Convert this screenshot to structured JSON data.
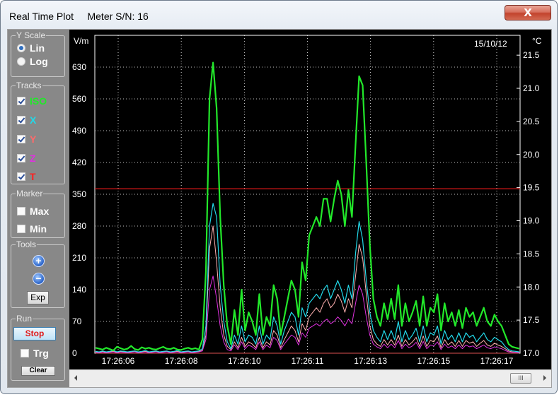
{
  "window": {
    "title": "Real Time Plot     Meter S/N: 16",
    "close_label": "X"
  },
  "sidebar": {
    "y_scale": {
      "label": "Y Scale",
      "options": [
        {
          "label": "Lin",
          "selected": true
        },
        {
          "label": "Log",
          "selected": false
        }
      ]
    },
    "tracks": {
      "label": "Tracks",
      "items": [
        {
          "label": "ISO",
          "checked": true,
          "color": "#22e82a"
        },
        {
          "label": "X",
          "checked": true,
          "color": "#22d8e8"
        },
        {
          "label": "Y",
          "checked": true,
          "color": "#ff6a6a"
        },
        {
          "label": "Z",
          "checked": true,
          "color": "#e030e0"
        },
        {
          "label": "T",
          "checked": true,
          "color": "#ff2020"
        }
      ]
    },
    "marker": {
      "label": "Marker",
      "items": [
        {
          "label": "Max",
          "checked": false
        },
        {
          "label": "Min",
          "checked": false
        }
      ]
    },
    "tools": {
      "label": "Tools",
      "zoom_in": "+",
      "zoom_out": "−",
      "export_label": "Exp"
    },
    "run": {
      "label": "Run",
      "stop_label": "Stop",
      "trg_label": "Trg",
      "trg_checked": false,
      "clear_label": "Clear"
    }
  },
  "plot": {
    "date": "15/10/12",
    "left_unit": "V/m",
    "right_unit": "°C",
    "scrollbar_thumb": "III"
  },
  "chart_data": {
    "type": "line",
    "title": "",
    "xlabel": "",
    "ylabel": "V/m",
    "y2label": "°C",
    "x_ticks": [
      "17:26:06",
      "17:26:08",
      "17:26:10",
      "17:26:11",
      "17:26:13",
      "17:26:15",
      "17:26:17"
    ],
    "y_ticks": [
      0,
      70,
      140,
      210,
      280,
      350,
      420,
      490,
      560,
      630
    ],
    "y2_ticks": [
      "17.0",
      "17.5",
      "18.0",
      "18.5",
      "19.0",
      "19.5",
      "20.0",
      "20.5",
      "21.0",
      "21.5"
    ],
    "ylim": [
      0,
      700
    ],
    "y2lim": [
      17.0,
      21.8
    ],
    "grid": true,
    "reference_line": {
      "value": 362,
      "color": "#e01818"
    },
    "series": [
      {
        "key": "iso",
        "color": "#22e82a",
        "width": 2.2,
        "values": [
          12,
          10,
          8,
          12,
          9,
          6,
          14,
          11,
          8,
          10,
          16,
          9,
          7,
          13,
          10,
          12,
          9,
          8,
          11,
          14,
          10,
          9,
          12,
          8,
          7,
          10,
          12,
          9,
          11,
          8,
          30,
          180,
          560,
          640,
          540,
          300,
          150,
          60,
          20,
          95,
          40,
          140,
          50,
          90,
          70,
          40,
          130,
          40,
          80,
          60,
          150,
          120,
          40,
          80,
          120,
          160,
          140,
          80,
          200,
          160,
          260,
          280,
          300,
          280,
          340,
          340,
          290,
          340,
          380,
          350,
          280,
          360,
          300,
          460,
          610,
          590,
          420,
          240,
          120,
          80,
          60,
          110,
          75,
          120,
          75,
          150,
          60,
          110,
          70,
          90,
          115,
          60,
          125,
          60,
          100,
          90,
          130,
          50,
          110,
          70,
          90,
          60,
          95,
          55,
          100,
          80,
          90,
          60,
          80,
          100,
          70,
          60,
          85,
          70,
          60,
          40,
          20,
          14,
          12,
          10
        ]
      },
      {
        "key": "x",
        "color": "#22d8e8",
        "width": 1.2,
        "values": [
          4,
          3,
          5,
          3,
          4,
          6,
          3,
          5,
          4,
          3,
          4,
          5,
          3,
          4,
          6,
          3,
          4,
          5,
          3,
          4,
          5,
          3,
          4,
          6,
          3,
          4,
          5,
          3,
          4,
          5,
          10,
          60,
          280,
          330,
          300,
          150,
          70,
          25,
          10,
          40,
          20,
          60,
          25,
          40,
          35,
          20,
          60,
          20,
          40,
          30,
          80,
          60,
          20,
          50,
          70,
          90,
          80,
          40,
          100,
          80,
          110,
          120,
          130,
          120,
          140,
          150,
          120,
          140,
          160,
          140,
          110,
          150,
          120,
          220,
          290,
          250,
          160,
          90,
          50,
          35,
          25,
          50,
          30,
          50,
          30,
          70,
          25,
          50,
          30,
          40,
          55,
          25,
          60,
          25,
          45,
          40,
          60,
          20,
          50,
          30,
          40,
          25,
          45,
          25,
          45,
          35,
          40,
          25,
          35,
          45,
          30,
          25,
          35,
          30,
          25,
          15,
          8,
          5,
          4,
          3
        ]
      },
      {
        "key": "y",
        "color": "#ffb0b0",
        "width": 1.0,
        "values": [
          3,
          2,
          4,
          2,
          3,
          4,
          2,
          4,
          3,
          2,
          3,
          4,
          2,
          3,
          4,
          2,
          3,
          4,
          2,
          3,
          4,
          2,
          3,
          4,
          2,
          3,
          4,
          2,
          3,
          4,
          6,
          40,
          230,
          280,
          200,
          100,
          40,
          15,
          8,
          25,
          12,
          35,
          15,
          25,
          20,
          12,
          35,
          12,
          25,
          18,
          50,
          40,
          12,
          30,
          45,
          60,
          50,
          25,
          65,
          50,
          80,
          90,
          100,
          90,
          110,
          120,
          100,
          110,
          130,
          115,
          90,
          120,
          100,
          170,
          240,
          210,
          130,
          60,
          30,
          20,
          15,
          30,
          18,
          30,
          18,
          40,
          15,
          30,
          18,
          25,
          35,
          15,
          38,
          15,
          28,
          25,
          38,
          12,
          30,
          18,
          25,
          15,
          28,
          15,
          28,
          22,
          25,
          15,
          22,
          28,
          18,
          15,
          22,
          18,
          15,
          10,
          5,
          3,
          2,
          2
        ]
      },
      {
        "key": "z",
        "color": "#e030e0",
        "width": 1.0,
        "values": [
          2,
          1,
          2,
          1,
          2,
          3,
          1,
          2,
          2,
          1,
          2,
          3,
          1,
          2,
          3,
          1,
          2,
          3,
          1,
          2,
          3,
          1,
          2,
          3,
          1,
          2,
          3,
          1,
          2,
          3,
          5,
          30,
          140,
          170,
          120,
          60,
          25,
          8,
          5,
          18,
          8,
          25,
          10,
          18,
          14,
          8,
          25,
          8,
          18,
          12,
          35,
          28,
          8,
          20,
          30,
          40,
          35,
          18,
          45,
          35,
          55,
          60,
          65,
          60,
          70,
          75,
          65,
          70,
          80,
          72,
          60,
          75,
          65,
          110,
          150,
          130,
          80,
          40,
          20,
          14,
          10,
          20,
          12,
          20,
          12,
          28,
          10,
          20,
          12,
          16,
          24,
          10,
          26,
          10,
          18,
          16,
          25,
          8,
          20,
          12,
          16,
          10,
          18,
          10,
          18,
          14,
          16,
          10,
          14,
          18,
          12,
          10,
          14,
          12,
          10,
          6,
          3,
          2,
          2,
          1
        ]
      },
      {
        "key": "t",
        "color": "#d21818",
        "width": 0.8,
        "values": [
          0,
          0,
          0,
          0,
          0,
          0,
          0,
          0,
          0,
          0,
          0,
          0,
          0,
          0,
          0,
          0,
          0,
          0,
          0,
          0,
          0,
          0,
          0,
          0,
          0,
          0,
          0,
          0,
          0,
          0,
          0,
          0,
          0,
          0,
          0,
          0,
          0,
          0,
          0,
          0,
          0,
          0,
          0,
          0,
          0,
          0,
          0,
          0,
          0,
          0,
          0,
          0,
          0,
          0,
          0,
          0,
          0,
          0,
          0,
          0,
          0,
          0,
          0,
          0,
          0,
          0,
          0,
          0,
          0,
          0,
          0,
          0,
          0,
          0,
          0,
          0,
          0,
          0,
          0,
          0,
          0,
          0,
          0,
          0,
          0,
          0,
          0,
          0,
          0,
          0,
          0,
          0,
          0,
          0,
          0,
          0,
          0,
          0,
          0,
          0,
          0,
          0,
          0,
          0,
          0,
          0,
          0,
          0,
          0,
          0,
          0,
          0,
          0,
          0,
          0,
          0,
          0,
          0,
          0,
          0
        ]
      }
    ]
  }
}
